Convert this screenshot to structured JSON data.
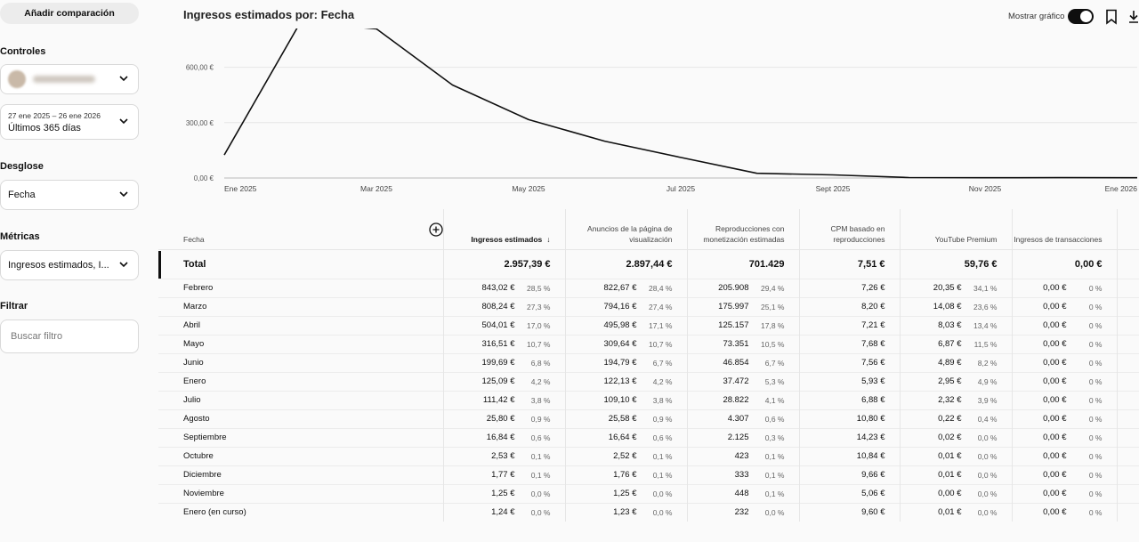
{
  "sidebar": {
    "add_comparison": "Añadir comparación",
    "controls_label": "Controles",
    "date_range": "27 ene 2025 – 26 ene 2026",
    "date_preset": "Últimos 365 días",
    "breakdown_label": "Desglose",
    "breakdown_value": "Fecha",
    "metrics_label": "Métricas",
    "metrics_value": "Ingresos estimados, I...",
    "filter_label": "Filtrar",
    "filter_placeholder": "Buscar filtro"
  },
  "header": {
    "title": "Ingresos estimados por: Fecha",
    "show_chart_label": "Mostrar gráfico",
    "show_chart_on": true,
    "icons": [
      "bookmark-icon",
      "download-icon"
    ]
  },
  "chart_data": {
    "type": "line",
    "title": "",
    "xlabel": "",
    "ylabel": "",
    "x": [
      "Ene 2025",
      "Feb 2025",
      "Mar 2025",
      "Abr 2025",
      "May 2025",
      "Jun 2025",
      "Jul 2025",
      "Ago 2025",
      "Sept 2025",
      "Oct 2025",
      "Nov 2025",
      "Dic 2025",
      "Ene 2026"
    ],
    "x_tick_labels": [
      "Ene 2025",
      "Mar 2025",
      "May 2025",
      "Jul 2025",
      "Sept 2025",
      "Nov 2025",
      "Ene 2026"
    ],
    "series": [
      {
        "values": [
          125.09,
          843.02,
          808.24,
          504.01,
          316.51,
          199.69,
          111.42,
          25.8,
          16.84,
          2.53,
          1.25,
          1.77,
          1.24
        ]
      }
    ],
    "y_tick_labels": [
      "0,00 €",
      "300,00 €",
      "600,00 €"
    ],
    "y_ticks": [
      0,
      300,
      600
    ],
    "ylim": [
      0,
      820
    ],
    "grid": true,
    "legend": "none",
    "line_color": "#0f0f0f"
  },
  "table": {
    "date_header": "Fecha",
    "add_column_icon": "plus-circle-icon",
    "columns": [
      {
        "label": "Ingresos estimados",
        "sorted": true,
        "sort_icon": "↓"
      },
      {
        "label": "Anuncios de la página de visualización"
      },
      {
        "label": "Reproducciones con monetización estimadas"
      },
      {
        "label": "CPM basado en reproducciones"
      },
      {
        "label": "YouTube Premium"
      },
      {
        "label": "Ingresos de transacciones"
      }
    ],
    "total": {
      "label": "Total",
      "values": [
        "2.957,39 €",
        "2.897,44 €",
        "701.429",
        "7,51 €",
        "59,76 €",
        "0,00 €"
      ]
    },
    "rows": [
      {
        "date": "Febrero",
        "cells": [
          [
            "843,02 €",
            "28,5 %"
          ],
          [
            "822,67 €",
            "28,4 %"
          ],
          [
            "205.908",
            "29,4 %"
          ],
          [
            "7,26 €",
            ""
          ],
          [
            "20,35 €",
            "34,1 %"
          ],
          [
            "0,00 €",
            "0 %"
          ]
        ]
      },
      {
        "date": "Marzo",
        "cells": [
          [
            "808,24 €",
            "27,3 %"
          ],
          [
            "794,16 €",
            "27,4 %"
          ],
          [
            "175.997",
            "25,1 %"
          ],
          [
            "8,20 €",
            ""
          ],
          [
            "14,08 €",
            "23,6 %"
          ],
          [
            "0,00 €",
            "0 %"
          ]
        ]
      },
      {
        "date": "Abril",
        "cells": [
          [
            "504,01 €",
            "17,0 %"
          ],
          [
            "495,98 €",
            "17,1 %"
          ],
          [
            "125.157",
            "17,8 %"
          ],
          [
            "7,21 €",
            ""
          ],
          [
            "8,03 €",
            "13,4 %"
          ],
          [
            "0,00 €",
            "0 %"
          ]
        ]
      },
      {
        "date": "Mayo",
        "cells": [
          [
            "316,51 €",
            "10,7 %"
          ],
          [
            "309,64 €",
            "10,7 %"
          ],
          [
            "73.351",
            "10,5 %"
          ],
          [
            "7,68 €",
            ""
          ],
          [
            "6,87 €",
            "11,5 %"
          ],
          [
            "0,00 €",
            "0 %"
          ]
        ]
      },
      {
        "date": "Junio",
        "cells": [
          [
            "199,69 €",
            "6,8 %"
          ],
          [
            "194,79 €",
            "6,7 %"
          ],
          [
            "46.854",
            "6,7 %"
          ],
          [
            "7,56 €",
            ""
          ],
          [
            "4,89 €",
            "8,2 %"
          ],
          [
            "0,00 €",
            "0 %"
          ]
        ]
      },
      {
        "date": "Enero",
        "cells": [
          [
            "125,09 €",
            "4,2 %"
          ],
          [
            "122,13 €",
            "4,2 %"
          ],
          [
            "37.472",
            "5,3 %"
          ],
          [
            "5,93 €",
            ""
          ],
          [
            "2,95 €",
            "4,9 %"
          ],
          [
            "0,00 €",
            "0 %"
          ]
        ]
      },
      {
        "date": "Julio",
        "cells": [
          [
            "111,42 €",
            "3,8 %"
          ],
          [
            "109,10 €",
            "3,8 %"
          ],
          [
            "28.822",
            "4,1 %"
          ],
          [
            "6,88 €",
            ""
          ],
          [
            "2,32 €",
            "3,9 %"
          ],
          [
            "0,00 €",
            "0 %"
          ]
        ]
      },
      {
        "date": "Agosto",
        "cells": [
          [
            "25,80 €",
            "0,9 %"
          ],
          [
            "25,58 €",
            "0,9 %"
          ],
          [
            "4.307",
            "0,6 %"
          ],
          [
            "10,80 €",
            ""
          ],
          [
            "0,22 €",
            "0,4 %"
          ],
          [
            "0,00 €",
            "0 %"
          ]
        ]
      },
      {
        "date": "Septiembre",
        "cells": [
          [
            "16,84 €",
            "0,6 %"
          ],
          [
            "16,64 €",
            "0,6 %"
          ],
          [
            "2.125",
            "0,3 %"
          ],
          [
            "14,23 €",
            ""
          ],
          [
            "0,02 €",
            "0,0 %"
          ],
          [
            "0,00 €",
            "0 %"
          ]
        ]
      },
      {
        "date": "Octubre",
        "cells": [
          [
            "2,53 €",
            "0,1 %"
          ],
          [
            "2,52 €",
            "0,1 %"
          ],
          [
            "423",
            "0,1 %"
          ],
          [
            "10,84 €",
            ""
          ],
          [
            "0,01 €",
            "0,0 %"
          ],
          [
            "0,00 €",
            "0 %"
          ]
        ]
      },
      {
        "date": "Diciembre",
        "cells": [
          [
            "1,77 €",
            "0,1 %"
          ],
          [
            "1,76 €",
            "0,1 %"
          ],
          [
            "333",
            "0,1 %"
          ],
          [
            "9,66 €",
            ""
          ],
          [
            "0,01 €",
            "0,0 %"
          ],
          [
            "0,00 €",
            "0 %"
          ]
        ]
      },
      {
        "date": "Noviembre",
        "cells": [
          [
            "1,25 €",
            "0,0 %"
          ],
          [
            "1,25 €",
            "0,0 %"
          ],
          [
            "448",
            "0,1 %"
          ],
          [
            "5,06 €",
            ""
          ],
          [
            "0,00 €",
            "0,0 %"
          ],
          [
            "0,00 €",
            "0 %"
          ]
        ]
      },
      {
        "date": "Enero (en curso)",
        "cells": [
          [
            "1,24 €",
            "0,0 %"
          ],
          [
            "1,23 €",
            "0,0 %"
          ],
          [
            "232",
            "0,0 %"
          ],
          [
            "9,60 €",
            ""
          ],
          [
            "0,01 €",
            "0,0 %"
          ],
          [
            "0,00 €",
            "0 %"
          ]
        ]
      }
    ]
  }
}
